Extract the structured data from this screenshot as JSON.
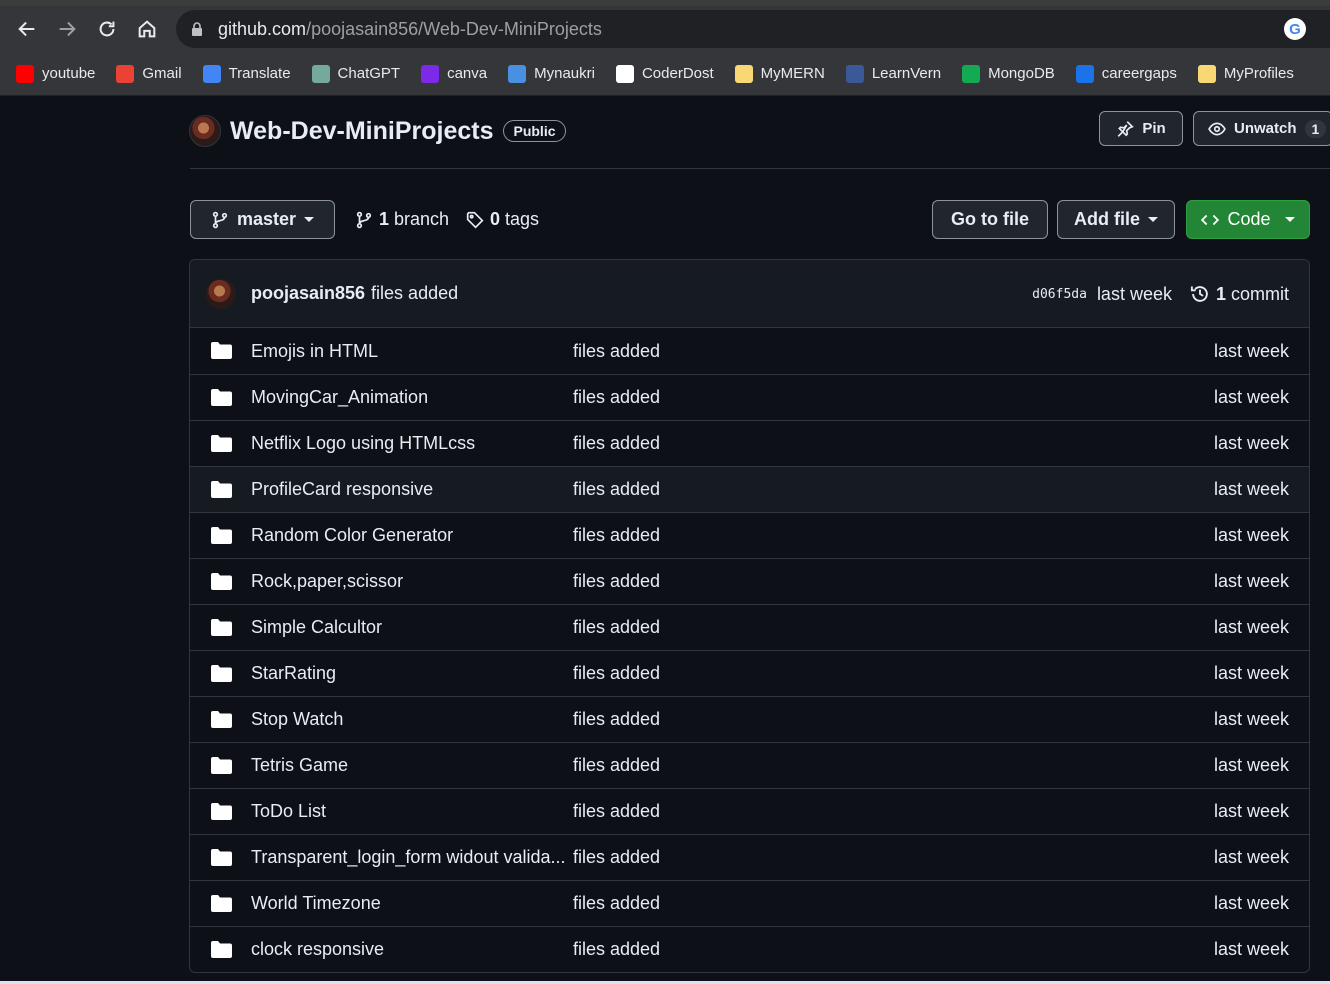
{
  "browser": {
    "url_host": "github.com",
    "url_path": "/poojasain856/Web-Dev-MiniProjects",
    "bookmarks": [
      {
        "label": "youtube",
        "icon": "youtube-icon",
        "color": "#ff0000"
      },
      {
        "label": "Gmail",
        "icon": "gmail-icon",
        "color": "#ea4335"
      },
      {
        "label": "Translate",
        "icon": "translate-icon",
        "color": "#4285f4"
      },
      {
        "label": "ChatGPT",
        "icon": "chatgpt-icon",
        "color": "#74aa9c"
      },
      {
        "label": "canva",
        "icon": "canva-icon",
        "color": "#7d2ae8"
      },
      {
        "label": "Mynaukri",
        "icon": "naukri-icon",
        "color": "#4a90e2"
      },
      {
        "label": "CoderDost",
        "icon": "coderdost-icon",
        "color": "#ffffff"
      },
      {
        "label": "MyMERN",
        "icon": "folder-icon",
        "color": "#f8d775"
      },
      {
        "label": "LearnVern",
        "icon": "learnvern-icon",
        "color": "#3b5998"
      },
      {
        "label": "MongoDB",
        "icon": "mongodb-icon",
        "color": "#13aa52"
      },
      {
        "label": "careergaps",
        "icon": "careergaps-icon",
        "color": "#1a73e8"
      },
      {
        "label": "MyProfiles",
        "icon": "folder-icon",
        "color": "#f8d775"
      }
    ]
  },
  "repo": {
    "name": "Web-Dev-MiniProjects",
    "visibility": "Public",
    "pin_label": "Pin",
    "watch_label": "Unwatch",
    "watch_count": "1"
  },
  "toolbar": {
    "branch": "master",
    "branch_count": "1",
    "branch_label": "branch",
    "tag_count": "0",
    "tag_label": "tags",
    "goto_file": "Go to file",
    "add_file": "Add file",
    "code": "Code"
  },
  "commit": {
    "author": "poojasain856",
    "message": "files added",
    "sha": "d06f5da",
    "when": "last week",
    "count": "1",
    "count_label": "commit"
  },
  "files": [
    {
      "name": "Emojis in HTML",
      "message": "files added",
      "age": "last week"
    },
    {
      "name": "MovingCar_Animation",
      "message": "files added",
      "age": "last week"
    },
    {
      "name": "Netflix Logo using HTMLcss",
      "message": "files added",
      "age": "last week"
    },
    {
      "name": "ProfileCard responsive",
      "message": "files added",
      "age": "last week"
    },
    {
      "name": "Random Color Generator",
      "message": "files added",
      "age": "last week"
    },
    {
      "name": "Rock,paper,scissor",
      "message": "files added",
      "age": "last week"
    },
    {
      "name": "Simple Calcultor",
      "message": "files added",
      "age": "last week"
    },
    {
      "name": "StarRating",
      "message": "files added",
      "age": "last week"
    },
    {
      "name": "Stop Watch",
      "message": "files added",
      "age": "last week"
    },
    {
      "name": "Tetris Game",
      "message": "files added",
      "age": "last week"
    },
    {
      "name": "ToDo List",
      "message": "files added",
      "age": "last week"
    },
    {
      "name": "Transparent_login_form widout valida...",
      "message": "files added",
      "age": "last week"
    },
    {
      "name": "World Timezone",
      "message": "files added",
      "age": "last week"
    },
    {
      "name": "clock responsive",
      "message": "files added",
      "age": "last week"
    }
  ],
  "colors": {
    "page_bg": "#0d1117",
    "code_button": "#238636",
    "border": "#30363d"
  }
}
